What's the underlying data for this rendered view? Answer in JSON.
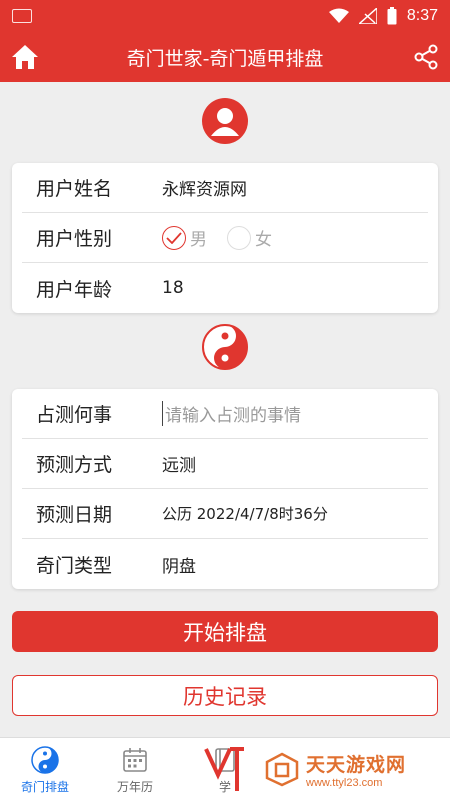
{
  "status": {
    "time": "8:37"
  },
  "appbar": {
    "title": "奇门世家-奇门遁甲排盘"
  },
  "user": {
    "name_label": "用户姓名",
    "name_value": "永辉资源网",
    "gender_label": "用户性别",
    "gender_options": [
      "男",
      "女"
    ],
    "gender_selected": "男",
    "age_label": "用户年龄",
    "age_value": "18"
  },
  "divination": {
    "matter_label": "占测何事",
    "matter_placeholder": "请输入占测的事情",
    "method_label": "预测方式",
    "method_value": "远测",
    "date_label": "预测日期",
    "date_value": "公历 2022/4/7/8时36分",
    "type_label": "奇门类型",
    "type_value": "阴盘"
  },
  "buttons": {
    "start": "开始排盘",
    "history": "历史记录"
  },
  "tabs": [
    {
      "label": "奇门排盘",
      "icon": "yinyang-icon",
      "active": true
    },
    {
      "label": "万年历",
      "icon": "calendar-icon",
      "active": false
    },
    {
      "label": "学",
      "icon": "book-icon",
      "active": false
    }
  ],
  "watermark": {
    "name": "天天游戏网",
    "url": "www.ttyl23.com"
  },
  "colors": {
    "primary": "#e0362f",
    "tab_active": "#1a73e8",
    "watermark": "#e07030"
  }
}
